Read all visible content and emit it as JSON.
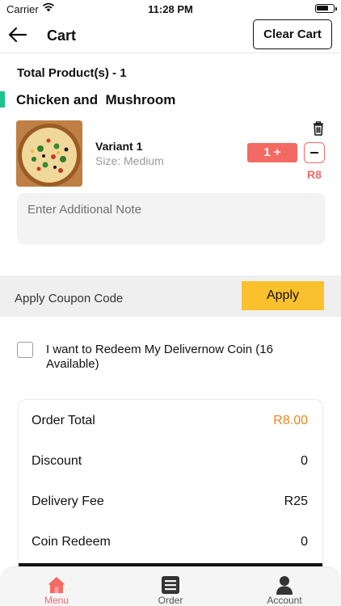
{
  "status_bar": {
    "carrier": "Carrier",
    "time": "11:28 PM"
  },
  "header": {
    "title": "Cart",
    "clear_label": "Clear Cart"
  },
  "cart": {
    "total_products": "Total Product(s) - 1",
    "items": [
      {
        "name": "Chicken and  Mushroom",
        "variant": "Variant 1",
        "size": "Size: Medium",
        "quantity_label": "1 +",
        "price": "R8"
      }
    ],
    "note_placeholder": "Enter Additional Note"
  },
  "coupon": {
    "label": "Apply Coupon Code",
    "apply_label": "Apply"
  },
  "redeem": {
    "text": "I want to Redeem My Delivernow Coin (16 Available)"
  },
  "summary": {
    "rows": [
      {
        "label": "Order Total",
        "value": "R8.00"
      },
      {
        "label": "Discount",
        "value": "0"
      },
      {
        "label": "Delivery Fee",
        "value": "R25"
      },
      {
        "label": "Coin Redeem",
        "value": "0"
      }
    ]
  },
  "tabs": [
    {
      "label": "Menu",
      "icon": "home-icon",
      "active": true
    },
    {
      "label": "Order",
      "icon": "order-list-icon",
      "active": false
    },
    {
      "label": "Account",
      "icon": "account-icon",
      "active": false
    }
  ],
  "colors": {
    "accent": "#f36a63",
    "apply": "#fbc02d",
    "green": "#1ec28b",
    "order_total": "#f0851a"
  }
}
